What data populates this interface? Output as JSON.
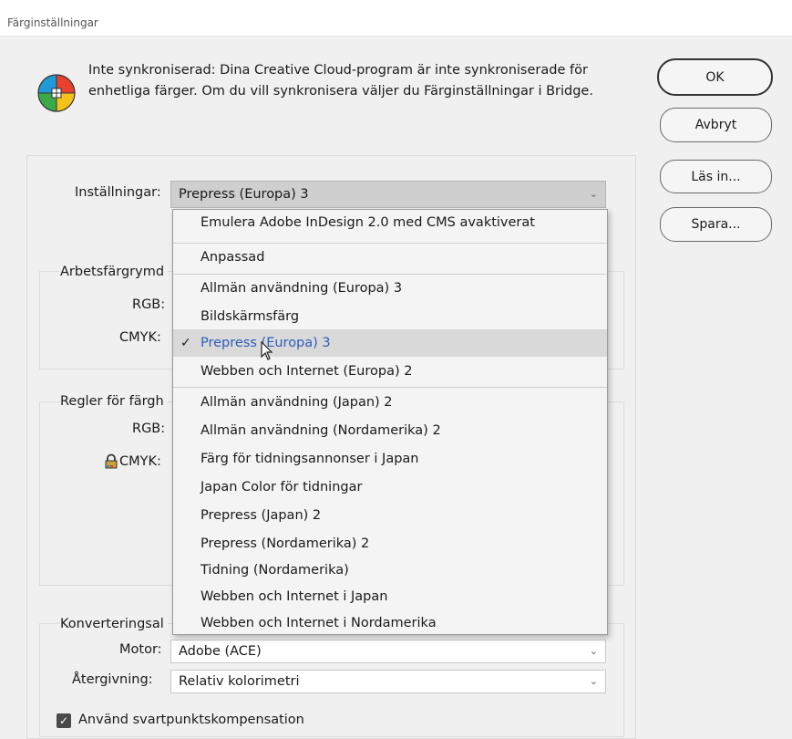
{
  "window": {
    "title": "Färginställningar"
  },
  "sync_message": "Inte synkroniserad: Dina Creative Cloud-program är inte synkroniserade för enhetliga färger. Om du vill synkronisera väljer du Färginställningar i Bridge.",
  "buttons": {
    "ok": "OK",
    "cancel": "Avbryt",
    "load": "Läs in...",
    "save": "Spara..."
  },
  "settings": {
    "label": "Inställningar:",
    "value": "Prepress (Europa) 3"
  },
  "working_spaces": {
    "title": "Arbetsfärgrymd",
    "rgb_label": "RGB:",
    "cmyk_label": "CMYK:"
  },
  "color_rules": {
    "title": "Regler för färgh",
    "rgb_label": "RGB:",
    "cmyk_label": "CMYK:"
  },
  "conversion": {
    "title": "Konverteringsal",
    "engine_label": "Motor:",
    "engine_value": "Adobe (ACE)",
    "intent_label": "Återgivning:",
    "intent_value": "Relativ kolorimetri"
  },
  "black_point": {
    "label": "Använd svartpunktskompensation",
    "checked": true
  },
  "dropdown": {
    "items": [
      "Emulera Adobe InDesign 2.0 med CMS avaktiverat",
      "Anpassad",
      "Allmän användning (Europa) 3",
      "Bildskärmsfärg",
      "Prepress (Europa) 3",
      "Webben och Internet (Europa) 2",
      "Allmän användning (Japan) 2",
      "Allmän användning (Nordamerika) 2",
      "Färg för tidningsannonser i Japan",
      "Japan Color för tidningar",
      "Prepress (Japan) 2",
      "Prepress (Nordamerika) 2",
      "Tidning (Nordamerika)",
      "Webben och Internet i Japan",
      "Webben och Internet i Nordamerika"
    ],
    "selected": "Prepress (Europa) 3"
  },
  "colors": {
    "selected_text": "#2e5cb8",
    "dialog_bg": "#f0f0f0"
  }
}
